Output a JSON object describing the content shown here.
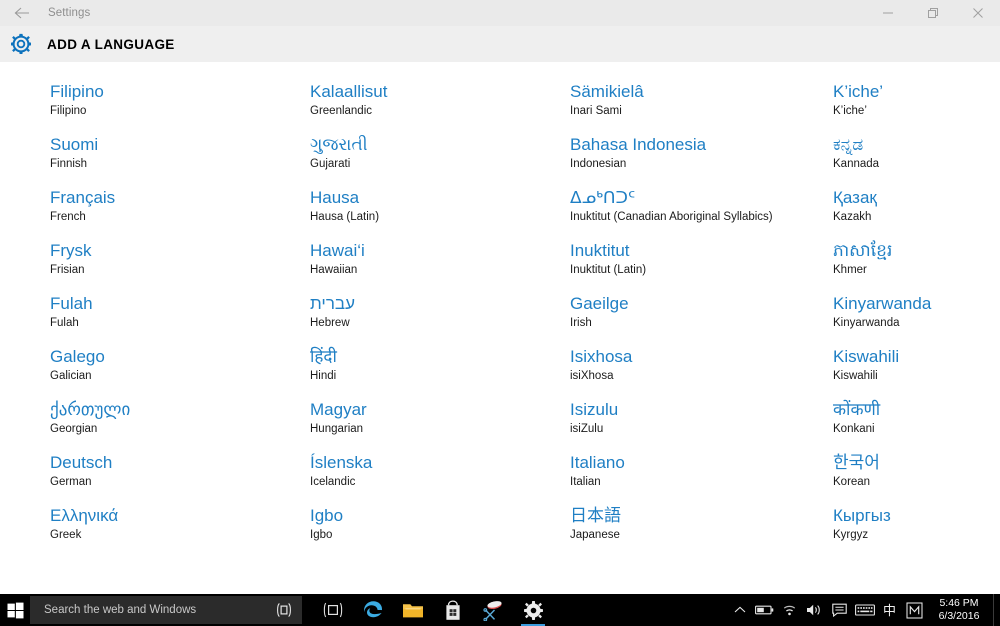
{
  "window": {
    "title_bar_label": "Settings",
    "back_icon": "back-arrow-icon",
    "minimize_label": "Minimize",
    "maximize_label": "Restore",
    "close_label": "Close"
  },
  "header": {
    "icon": "gear-icon",
    "title": "ADD A LANGUAGE",
    "accent_color": "#0078d7"
  },
  "colors": {
    "native_blue": "#1f7fc4",
    "english_black": "#1b1b1b",
    "header_bg": "#efefef",
    "titlebar_bg": "#eaeaea",
    "taskbar_bg": "#000000",
    "search_bg": "#2b2b2b",
    "active_underline": "#3a9bdc"
  },
  "languages": {
    "columns": [
      [
        {
          "native": "Filipino",
          "english": "Filipino"
        },
        {
          "native": "Suomi",
          "english": "Finnish"
        },
        {
          "native": "Français",
          "english": "French"
        },
        {
          "native": "Frysk",
          "english": "Frisian"
        },
        {
          "native": "Fulah",
          "english": "Fulah"
        },
        {
          "native": "Galego",
          "english": "Galician"
        },
        {
          "native": "ქართული",
          "english": "Georgian"
        },
        {
          "native": "Deutsch",
          "english": "German"
        },
        {
          "native": "Ελληνικά",
          "english": "Greek"
        }
      ],
      [
        {
          "native": "Kalaallisut",
          "english": "Greenlandic"
        },
        {
          "native": "ગુજરાતી",
          "english": "Gujarati"
        },
        {
          "native": "Hausa",
          "english": "Hausa (Latin)"
        },
        {
          "native": "Hawai‘i",
          "english": "Hawaiian"
        },
        {
          "native": "עברית",
          "english": "Hebrew"
        },
        {
          "native": "हिंदी",
          "english": "Hindi"
        },
        {
          "native": "Magyar",
          "english": "Hungarian"
        },
        {
          "native": "Íslenska",
          "english": "Icelandic"
        },
        {
          "native": "Igbo",
          "english": "Igbo"
        }
      ],
      [
        {
          "native": "Sämikielâ",
          "english": "Inari Sami"
        },
        {
          "native": "Bahasa Indonesia",
          "english": "Indonesian"
        },
        {
          "native": "ᐃᓄᒃᑎᑐᑦ",
          "english": "Inuktitut (Canadian Aboriginal Syllabics)"
        },
        {
          "native": "Inuktitut",
          "english": "Inuktitut (Latin)"
        },
        {
          "native": "Gaeilge",
          "english": "Irish"
        },
        {
          "native": "Isixhosa",
          "english": "isiXhosa"
        },
        {
          "native": "Isizulu",
          "english": "isiZulu"
        },
        {
          "native": "Italiano",
          "english": "Italian"
        },
        {
          "native": "日本語",
          "english": "Japanese"
        }
      ],
      [
        {
          "native": "K’iche’",
          "english": "K’iche’"
        },
        {
          "native": "ಕನ್ನಡ",
          "english": "Kannada"
        },
        {
          "native": "Қазақ",
          "english": "Kazakh"
        },
        {
          "native": "ភាសាខ្មែរ",
          "english": "Khmer"
        },
        {
          "native": "Kinyarwanda",
          "english": "Kinyarwanda"
        },
        {
          "native": "Kiswahili",
          "english": "Kiswahili"
        },
        {
          "native": "कोंकणी",
          "english": "Konkani"
        },
        {
          "native": "한국어",
          "english": "Korean"
        },
        {
          "native": "Кыргыз",
          "english": "Kyrgyz"
        }
      ]
    ]
  },
  "taskbar": {
    "start_label": "Start",
    "search_placeholder": "Search the web and Windows",
    "cortana_icon": "cortana-circle-icon",
    "apps": [
      {
        "name": "task-view",
        "label": "Task View",
        "active": false
      },
      {
        "name": "microsoft-edge",
        "label": "Microsoft Edge",
        "active": false
      },
      {
        "name": "file-explorer",
        "label": "File Explorer",
        "active": false
      },
      {
        "name": "microsoft-store",
        "label": "Store",
        "active": false
      },
      {
        "name": "snipping-tool",
        "label": "Snipping Tool",
        "active": false
      },
      {
        "name": "settings",
        "label": "Settings",
        "active": true
      }
    ],
    "tray": {
      "show_hidden_label": "Show hidden icons",
      "battery_label": "Battery",
      "network_label": "Network",
      "volume_label": "Volume",
      "action_center_label": "Action Center",
      "touch_keyboard_label": "Touch keyboard",
      "ime_mode_glyph": "中",
      "ime_pad_glyph": "M"
    },
    "clock": {
      "time": "5:46 PM",
      "date": "6/3/2016"
    }
  }
}
